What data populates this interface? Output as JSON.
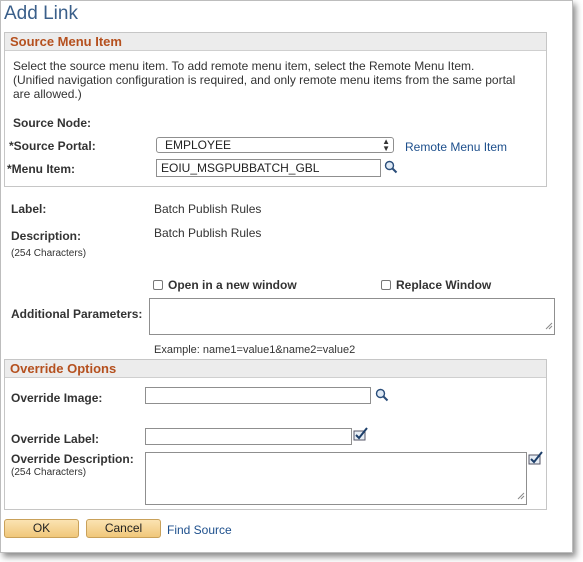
{
  "page": {
    "title": "Add Link"
  },
  "source_menu_item": {
    "header": "Source Menu Item",
    "instructions": [
      "Select the source menu item. To add remote menu item, select the Remote Menu Item.",
      "(Unified navigation configuration is required, and only remote menu items from the same portal",
      "are allowed.)"
    ],
    "source_node_label": "Source Node:",
    "source_portal_label": "*Source Portal:",
    "source_portal_value": "EMPLOYEE",
    "remote_menu_item_link": "Remote Menu Item",
    "menu_item_label": "*Menu Item:",
    "menu_item_value": "EOIU_MSGPUBBATCH_GBL"
  },
  "details": {
    "label_label": "Label:",
    "label_value": "Batch Publish Rules",
    "description_label": "Description:",
    "description_value": "Batch Publish Rules",
    "description_hint": "(254 Characters)",
    "open_new_window_label": "Open in a new window",
    "replace_window_label": "Replace Window",
    "additional_parameters_label": "Additional Parameters:",
    "additional_parameters_value": "",
    "example_text": "Example: name1=value1&name2=value2"
  },
  "override_options": {
    "header": "Override Options",
    "image_label": "Override Image:",
    "image_value": "",
    "label_label": "Override Label:",
    "label_value": "",
    "description_label": "Override Description:",
    "description_hint": "(254 Characters)",
    "description_value": ""
  },
  "actions": {
    "ok_label": "OK",
    "cancel_label": "Cancel",
    "find_source_label": "Find Source"
  },
  "colors": {
    "title": "#3a5f8a",
    "group_header_text": "#b5501e",
    "link": "#1d4f8c",
    "button_fill": "#f0c77a"
  },
  "icons": {
    "lookup": "magnifier-icon",
    "spellcheck": "spellcheck-icon"
  }
}
